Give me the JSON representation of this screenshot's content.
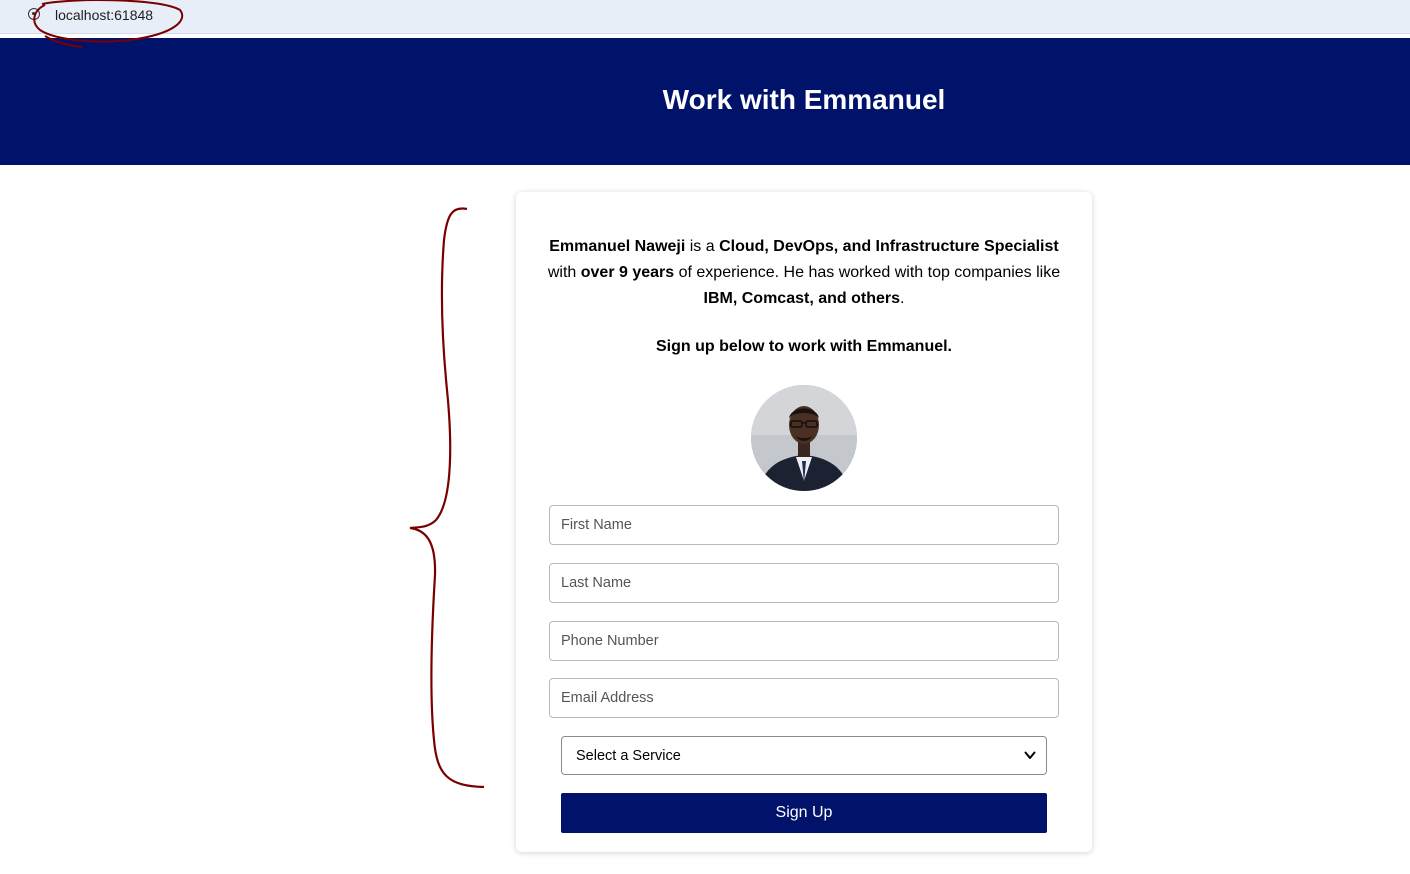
{
  "browser": {
    "url": "localhost:61848"
  },
  "hero": {
    "title": "Work with Emmanuel"
  },
  "intro": {
    "name": "Emmanuel Naweji",
    "t1": " is a ",
    "role": "Cloud, DevOps, and Infrastructure Specialist",
    "t2": " with ",
    "years": "over 9 years",
    "t3": " of experience. He has worked with top companies like ",
    "companies": "IBM, Comcast, and others",
    "t4": "."
  },
  "cta": "Sign up below to work with Emmanuel.",
  "form": {
    "first_name_placeholder": "First Name",
    "last_name_placeholder": "Last Name",
    "phone_placeholder": "Phone Number",
    "email_placeholder": "Email Address",
    "service_selected": "Select a Service",
    "submit_label": "Sign Up"
  },
  "colors": {
    "brand": "#00126a",
    "annotation": "#7a0000"
  }
}
